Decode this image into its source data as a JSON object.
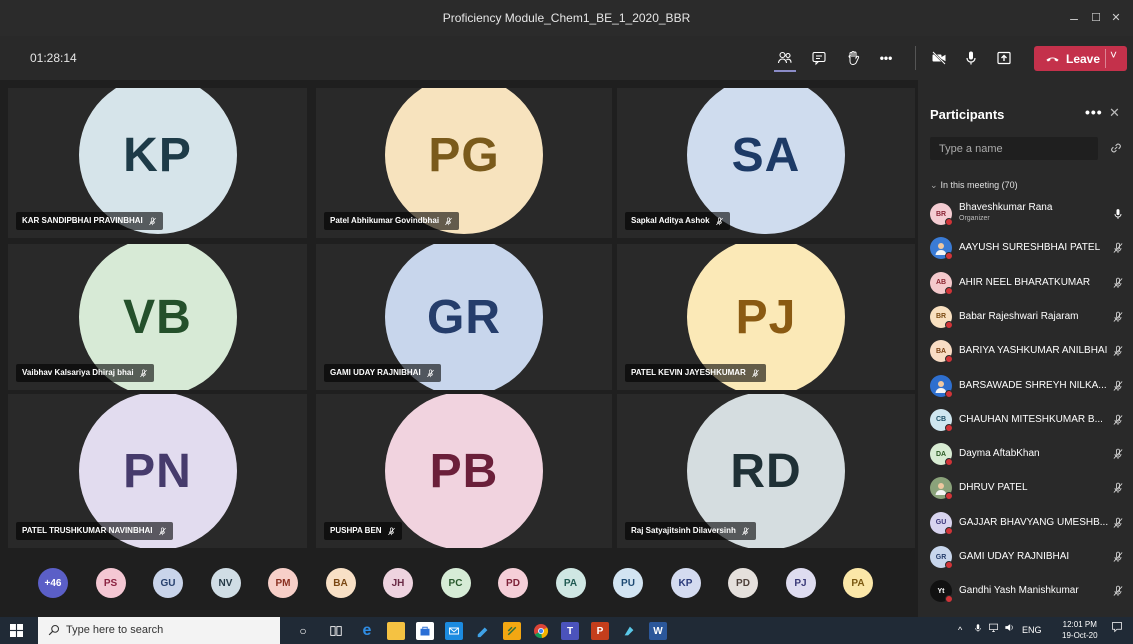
{
  "window": {
    "title": "Proficiency Module_Chem1_BE_1_2020_BBR",
    "minimize": "–",
    "maximize": "☐",
    "close": "✕"
  },
  "toolbar": {
    "timer": "01:28:14",
    "leave_label": "Leave",
    "more": "•••",
    "leave_chevron": "˅"
  },
  "tiles": [
    {
      "initials": "KP",
      "name": "KAR SANDIPBHAI PRAVINBHAI",
      "bg": "#d6e4ea",
      "fg": "#1e3b48"
    },
    {
      "initials": "PG",
      "name": "Patel Abhikumar Govindbhai",
      "bg": "#f7e3be",
      "fg": "#7a5a1b"
    },
    {
      "initials": "SA",
      "name": "Sapkal Aditya Ashok",
      "bg": "#cfdcee",
      "fg": "#1d3a66"
    },
    {
      "initials": "VB",
      "name": "Vaibhav Kalsariya Dhiraj bhai",
      "bg": "#d7ead6",
      "fg": "#24502b"
    },
    {
      "initials": "GR",
      "name": "GAMI UDAY RAJNIBHAI",
      "bg": "#c8d6ec",
      "fg": "#253d6b"
    },
    {
      "initials": "PJ",
      "name": "PATEL KEVIN JAYESHKUMAR",
      "bg": "#fbe9b7",
      "fg": "#8a5a12"
    },
    {
      "initials": "PN",
      "name": "PATEL TRUSHKUMAR NAVINBHAI",
      "bg": "#e2dcef",
      "fg": "#463b6c"
    },
    {
      "initials": "PB",
      "name": "PUSHPA BEN",
      "bg": "#f1d3df",
      "fg": "#6b1f3a"
    },
    {
      "initials": "RD",
      "name": "Raj Satyajitsinh Dilaversinh",
      "bg": "#d5dde0",
      "fg": "#1f3036"
    }
  ],
  "strip": [
    {
      "label": "+46",
      "bg": "#5b5fc7",
      "fg": "#ffffff"
    },
    {
      "label": "PS",
      "bg": "#f4c7d3",
      "fg": "#8a2240"
    },
    {
      "label": "GU",
      "bg": "#c9d4ea",
      "fg": "#27406e"
    },
    {
      "label": "NV",
      "bg": "#d0dde5",
      "fg": "#253a47"
    },
    {
      "label": "PM",
      "bg": "#f7cfc8",
      "fg": "#8a2f20"
    },
    {
      "label": "BA",
      "bg": "#f8e0c6",
      "fg": "#7a4714"
    },
    {
      "label": "JH",
      "bg": "#eed3df",
      "fg": "#6a2a45"
    },
    {
      "label": "PC",
      "bg": "#d6ecd6",
      "fg": "#2a5a2e"
    },
    {
      "label": "PD",
      "bg": "#f5cfd8",
      "fg": "#7d2238"
    },
    {
      "label": "PA",
      "bg": "#cfe7e3",
      "fg": "#1f5a52"
    },
    {
      "label": "PU",
      "bg": "#d2e4f2",
      "fg": "#1d4a73"
    },
    {
      "label": "KP",
      "bg": "#d4dbf0",
      "fg": "#2a3a7a"
    },
    {
      "label": "PD",
      "bg": "#e5e0dc",
      "fg": "#4d403a"
    },
    {
      "label": "PJ",
      "bg": "#dedcf0",
      "fg": "#3b3a78"
    },
    {
      "label": "PA",
      "bg": "#fbe7a8",
      "fg": "#7b5810"
    }
  ],
  "participants_panel": {
    "title": "Participants",
    "more": "•••",
    "close": "✕",
    "search_placeholder": "Type a name",
    "section_label": "In this meeting (70)",
    "members": [
      {
        "initials": "BR",
        "name": "Bhaveshkumar Rana",
        "role": "Organizer",
        "bg": "#f4ccd2",
        "fg": "#8a2435",
        "mic": "on"
      },
      {
        "initials": "",
        "name": "AAYUSH SURESHBHAI PATEL",
        "role": "",
        "bg": "#3a7bd5",
        "fg": "#ffffff",
        "mic": "off"
      },
      {
        "initials": "AB",
        "name": "AHIR NEEL BHARATKUMAR",
        "role": "",
        "bg": "#f4c9cc",
        "fg": "#8a2430",
        "mic": "off"
      },
      {
        "initials": "BR",
        "name": "Babar Rajeshwari Rajaram",
        "role": "",
        "bg": "#f8e0c0",
        "fg": "#7a4a12",
        "mic": "off"
      },
      {
        "initials": "BA",
        "name": "BARIYA YASHKUMAR ANILBHAI",
        "role": "",
        "bg": "#f8dcc4",
        "fg": "#7a3f12",
        "mic": "off"
      },
      {
        "initials": "",
        "name": "BARSAWADE SHREYH NILKA...",
        "role": "",
        "bg": "#2e6fcf",
        "fg": "#ffffff",
        "mic": "off"
      },
      {
        "initials": "CB",
        "name": "CHAUHAN MITESHKUMAR B...",
        "role": "",
        "bg": "#cfe7f0",
        "fg": "#1d5066",
        "mic": "off"
      },
      {
        "initials": "DA",
        "name": "Dayma AftabKhan",
        "role": "",
        "bg": "#d8ecd3",
        "fg": "#2c5a24",
        "mic": "off"
      },
      {
        "initials": "",
        "name": "DHRUV PATEL",
        "role": "",
        "bg": "#8aa27a",
        "fg": "#ffffff",
        "mic": "off"
      },
      {
        "initials": "GU",
        "name": "GAJJAR BHAVYANG UMESHB...",
        "role": "",
        "bg": "#d8d4ef",
        "fg": "#3a3478",
        "mic": "off"
      },
      {
        "initials": "GR",
        "name": "GAMI UDAY RAJNIBHAI",
        "role": "",
        "bg": "#c8d6ec",
        "fg": "#253d6b",
        "mic": "off"
      },
      {
        "initials": "Yt",
        "name": "Gandhi Yash Manishkumar",
        "role": "",
        "bg": "#111111",
        "fg": "#ffffff",
        "mic": "off"
      }
    ]
  },
  "taskbar": {
    "search_placeholder": "Type here to search",
    "lang": "ENG",
    "time": "12:01 PM",
    "date": "19-Oct-20",
    "tray_up": "^"
  }
}
